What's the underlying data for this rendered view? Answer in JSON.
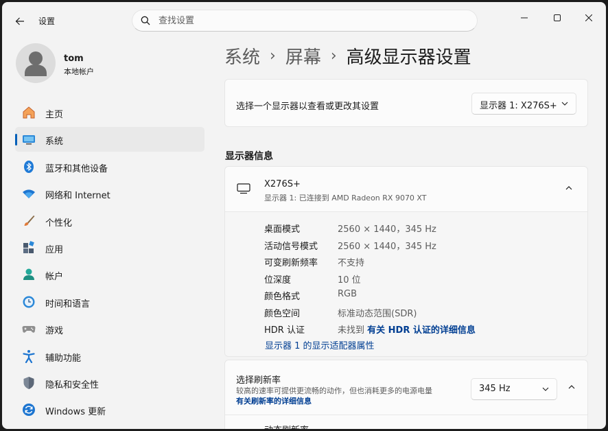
{
  "window": {
    "title": "设置",
    "controls": [
      "minimize",
      "maximize",
      "close"
    ]
  },
  "search": {
    "placeholder": "查找设置",
    "value": ""
  },
  "user": {
    "name": "tom",
    "account_type": "本地帐户"
  },
  "sidebar": {
    "items": [
      {
        "label": "主页",
        "icon": "home-icon",
        "active": false
      },
      {
        "label": "系统",
        "icon": "system-display-icon",
        "active": true
      },
      {
        "label": "蓝牙和其他设备",
        "icon": "bluetooth-icon",
        "active": false
      },
      {
        "label": "网络和 Internet",
        "icon": "wifi-icon",
        "active": false
      },
      {
        "label": "个性化",
        "icon": "brush-icon",
        "active": false
      },
      {
        "label": "应用",
        "icon": "apps-icon",
        "active": false
      },
      {
        "label": "帐户",
        "icon": "account-icon",
        "active": false
      },
      {
        "label": "时间和语言",
        "icon": "time-language-icon",
        "active": false
      },
      {
        "label": "游戏",
        "icon": "gamepad-icon",
        "active": false
      },
      {
        "label": "辅助功能",
        "icon": "accessibility-icon",
        "active": false
      },
      {
        "label": "隐私和安全性",
        "icon": "shield-icon",
        "active": false
      },
      {
        "label": "Windows 更新",
        "icon": "update-icon",
        "active": false
      }
    ]
  },
  "breadcrumb": {
    "level1": "系统",
    "level2": "屏幕",
    "current": "高级显示器设置",
    "separator": "›"
  },
  "display_select": {
    "label": "选择一个显示器以查看或更改其设置",
    "selected": "显示器 1: X276S+"
  },
  "display_info": {
    "section_title": "显示器信息",
    "monitor_name": "X276S+",
    "monitor_subtitle": "显示器 1: 已连接到 AMD Radeon RX 9070 XT",
    "rows": [
      {
        "key": "桌面模式",
        "value": "2560 × 1440，345 Hz"
      },
      {
        "key": "活动信号模式",
        "value": "2560 × 1440，345 Hz"
      },
      {
        "key": "可变刷新频率",
        "value": "不支持"
      },
      {
        "key": "位深度",
        "value": "10 位"
      },
      {
        "key": "颜色格式",
        "value": "RGB"
      },
      {
        "key": "颜色空间",
        "value": "标准动态范围(SDR)"
      }
    ],
    "hdr": {
      "key": "HDR 认证",
      "value_prefix": "未找到",
      "link": "有关 HDR 认证的详细信息"
    },
    "adapter_link": "显示器 1 的显示适配器属性"
  },
  "refresh_rate": {
    "title": "选择刷新率",
    "description": "较高的速率可提供更流畅的动作，但也消耗更多的电源电量",
    "link": "有关刷新率的详细信息",
    "selected": "345 Hz",
    "next_item": "动态刷新率"
  },
  "colors": {
    "accent": "#005fb8",
    "link": "#003e92",
    "background": "#f3f3f3",
    "card": "#fbfbfb"
  }
}
